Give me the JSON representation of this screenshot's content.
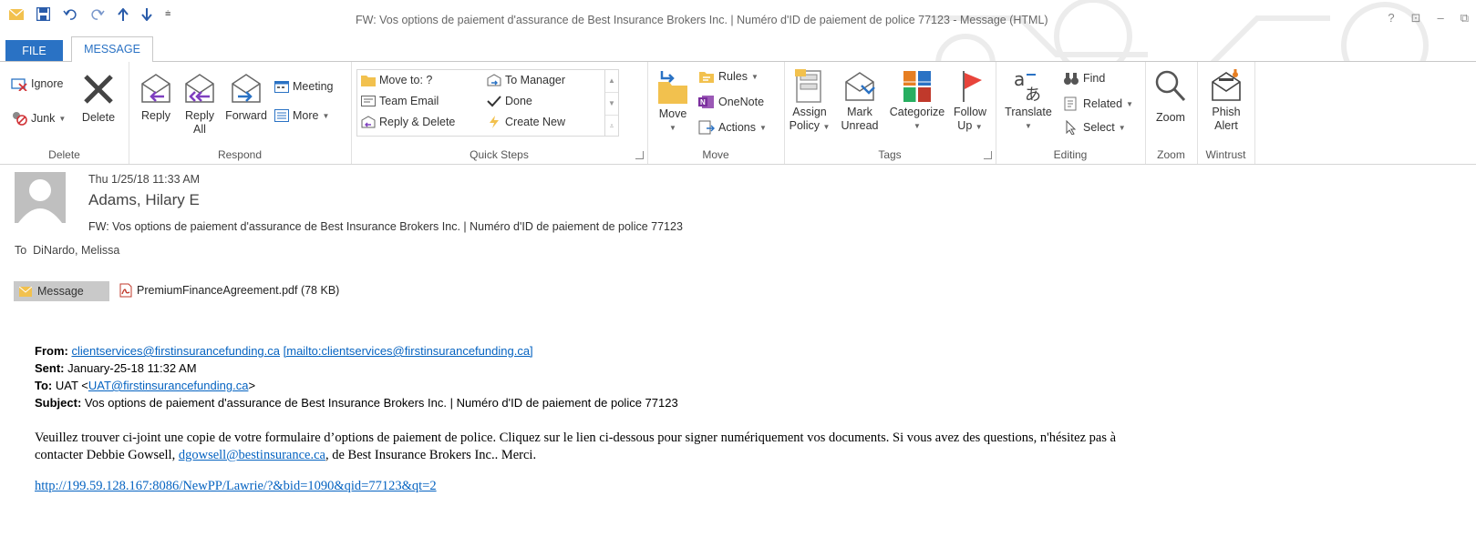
{
  "window": {
    "title": "FW: Vos options de paiement d'assurance de Best Insurance Brokers Inc. | Numéro d'ID de paiement de police 77123 - Message (HTML)",
    "controls": [
      "?",
      "⊡",
      "–",
      "⧉"
    ]
  },
  "tabs": [
    "FILE",
    "MESSAGE"
  ],
  "ribbon": {
    "delete": {
      "label": "Delete",
      "ignore": "Ignore",
      "junk": "Junk",
      "delete_btn": "Delete"
    },
    "respond": {
      "label": "Respond",
      "reply": "Reply",
      "reply_all": [
        "Reply",
        "All"
      ],
      "forward": "Forward",
      "meeting": "Meeting",
      "more": "More"
    },
    "quick_steps": {
      "label": "Quick Steps",
      "move_to": "Move to: ?",
      "team_email": "Team Email",
      "reply_delete": "Reply & Delete",
      "to_manager": "To Manager",
      "done": "Done",
      "create_new": "Create New"
    },
    "move": {
      "label": "Move",
      "move_btn": "Move",
      "rules": "Rules",
      "onenote": "OneNote",
      "actions": "Actions"
    },
    "tags": {
      "label": "Tags",
      "assign_policy": [
        "Assign",
        "Policy"
      ],
      "mark_unread": [
        "Mark",
        "Unread"
      ],
      "categorize": "Categorize",
      "follow_up": [
        "Follow",
        "Up"
      ]
    },
    "editing": {
      "label": "Editing",
      "translate": "Translate",
      "find": "Find",
      "related": "Related",
      "select": "Select"
    },
    "zoom": {
      "label": "Zoom",
      "zoom_btn": "Zoom"
    },
    "wintrust": {
      "label": "Wintrust",
      "phish_alert": [
        "Phish",
        "Alert"
      ]
    }
  },
  "email": {
    "datetime": "Thu 1/25/18 11:33 AM",
    "sender": "Adams, Hilary E",
    "subject": "FW: Vos options de paiement d'assurance de Best Insurance Brokers Inc. | Numéro d'ID de paiement de police 77123",
    "to_label": "To",
    "to": "DiNardo, Melissa",
    "attachments": {
      "message_tab": "Message",
      "pdf": "PremiumFinanceAgreement.pdf (78 KB)"
    },
    "forward_header": {
      "from_label": "From:",
      "from_email": "clientservices@firstinsurancefunding.ca",
      "from_mailto": "[mailto:clientservices@firstinsurancefunding.ca]",
      "sent_label": "Sent:",
      "sent_value": "January-25-18 11:32 AM",
      "to_label": "To:",
      "to_name": "UAT <",
      "to_email": "UAT@firstinsurancefunding.ca",
      "to_close": ">",
      "subject_label": "Subject:",
      "subject_value": "Vos options de paiement d'assurance de Best Insurance Brokers Inc. | Numéro d'ID de paiement de police 77123"
    },
    "body_line1": "Veuillez trouver ci-joint une copie de votre formulaire d’options de paiement de police. Cliquez sur le lien ci-dessous pour signer numériquement vos documents. Si vous avez des questions, n'hésitez pas à",
    "body_line2_pre": "contacter Debbie Gowsell, ",
    "body_line2_email": "dgowsell@bestinsurance.ca",
    "body_line2_post": ", de Best Insurance Brokers Inc.. Merci.",
    "link": "http://199.59.128.167:8086/NewPP/Lawrie/?&bid=1090&qid=77123&qt=2"
  },
  "colors": {
    "accent": "#2a72c4",
    "link": "#0563c1",
    "avatar": "#bfbfbf"
  }
}
